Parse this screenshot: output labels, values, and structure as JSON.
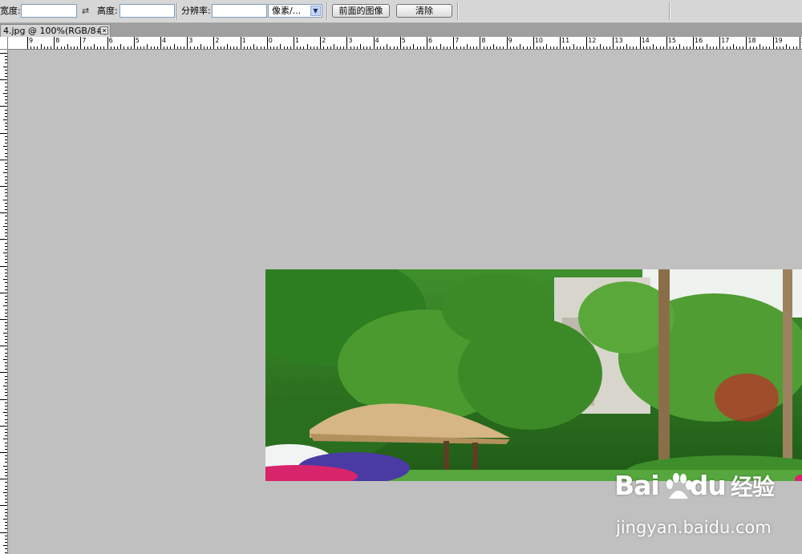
{
  "options_bar": {
    "width_label": "宽度:",
    "height_label": "高度:",
    "resolution_label": "分辨率:",
    "width_value": "",
    "height_value": "",
    "resolution_value": "",
    "unit_select": "像素/...",
    "front_image_button": "前面的图像",
    "clear_button": "清除"
  },
  "document_tab": {
    "title": "4.jpg @ 100%(RGB/8#)",
    "close_glyph": "✕"
  },
  "ruler": {
    "labels": [
      "9",
      "8",
      "7",
      "6",
      "5",
      "4",
      "3",
      "2",
      "1",
      "0",
      "1",
      "2",
      "3",
      "4",
      "5",
      "6",
      "7",
      "8",
      "9",
      "10",
      "11",
      "12",
      "13",
      "14",
      "15",
      "16",
      "17",
      "18",
      "19",
      "2"
    ]
  },
  "watermark": {
    "brand": "Bai",
    "brand_suffix": "du",
    "brand_cn": "经验",
    "url": "jingyan.baidu.com"
  },
  "colors": {
    "canvas_bg": "#c0c0c0",
    "toolbar_bg": "#d6d6d6",
    "tab_strip": "#9f9f9f"
  }
}
